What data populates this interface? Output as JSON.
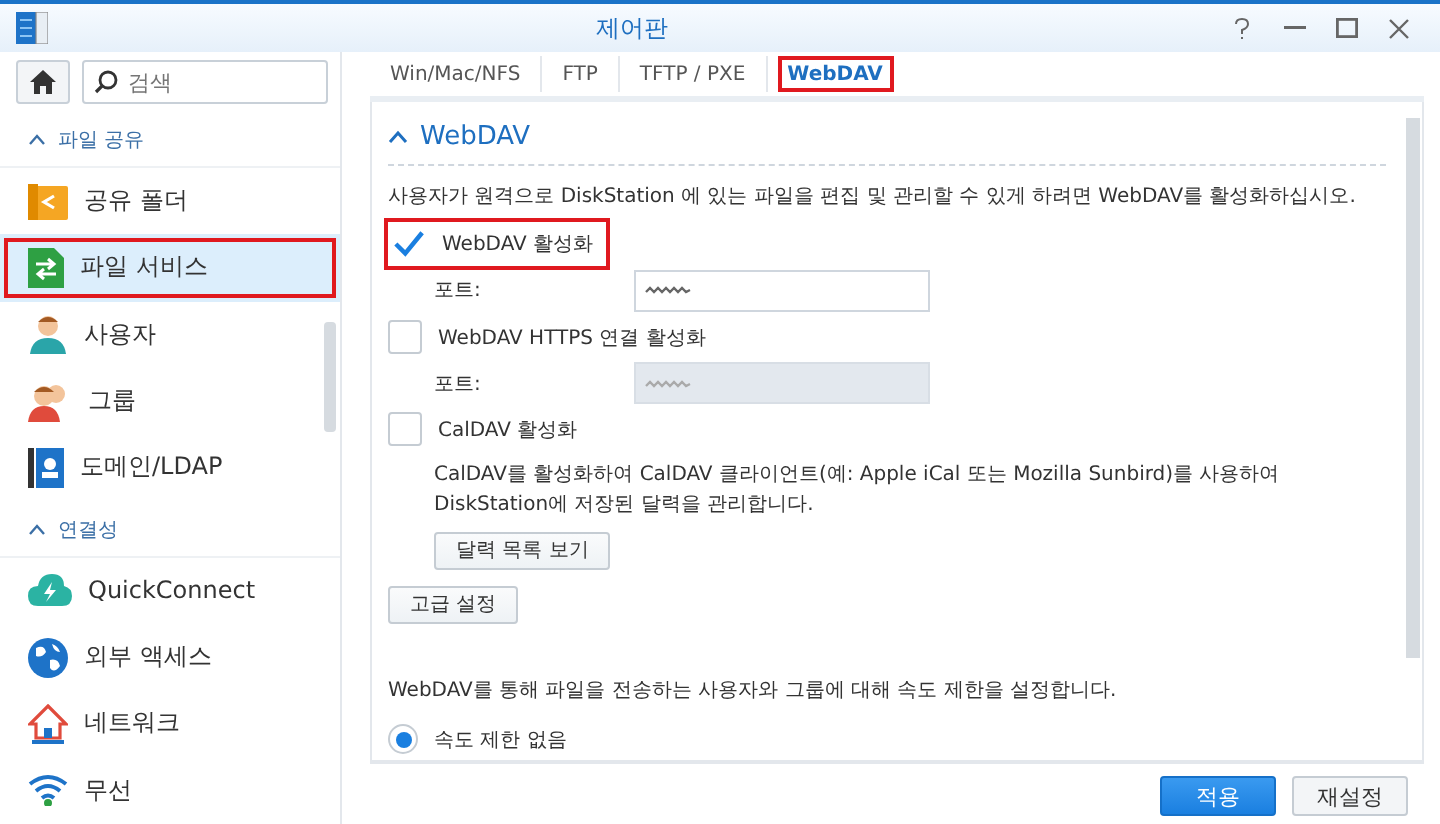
{
  "window": {
    "title": "제어판"
  },
  "search": {
    "placeholder": "검색"
  },
  "sidebar": {
    "items": [
      {
        "kind": "section",
        "label": "파일 공유",
        "expanded": true
      },
      {
        "kind": "item",
        "label": "공유 폴더",
        "selected": false,
        "highlighted": false
      },
      {
        "kind": "item",
        "label": "파일 서비스",
        "selected": true,
        "highlighted": true
      },
      {
        "kind": "item",
        "label": "사용자",
        "selected": false,
        "highlighted": false
      },
      {
        "kind": "item",
        "label": "그룹",
        "selected": false,
        "highlighted": false
      },
      {
        "kind": "item",
        "label": "도메인/LDAP",
        "selected": false,
        "highlighted": false
      },
      {
        "kind": "section",
        "label": "연결성",
        "expanded": true
      },
      {
        "kind": "item",
        "label": "QuickConnect",
        "selected": false,
        "highlighted": false
      },
      {
        "kind": "item",
        "label": "외부 액세스",
        "selected": false,
        "highlighted": false
      },
      {
        "kind": "item",
        "label": "네트워크",
        "selected": false,
        "highlighted": false
      },
      {
        "kind": "item",
        "label": "무선",
        "selected": false,
        "highlighted": false
      }
    ]
  },
  "tabs": [
    {
      "label": "Win/Mac/NFS",
      "selected": false,
      "highlighted": false
    },
    {
      "label": "FTP",
      "selected": false,
      "highlighted": false
    },
    {
      "label": "TFTP / PXE",
      "selected": false,
      "highlighted": false
    },
    {
      "label": "WebDAV",
      "selected": true,
      "highlighted": true
    }
  ],
  "panel": {
    "title": "WebDAV",
    "expanded": true,
    "description": "사용자가 원격으로 DiskStation 에 있는 파일을 편집 및 관리할 수 있게 하려면 WebDAV를 활성화하십시오.",
    "rows": [
      {
        "kind": "checkbox",
        "label": "WebDAV 활성화",
        "checked": true,
        "highlighted": true
      },
      {
        "kind": "port",
        "label": "포트:",
        "disabled": false
      },
      {
        "kind": "checkbox",
        "label": "WebDAV HTTPS 연결 활성화",
        "checked": false,
        "highlighted": false
      },
      {
        "kind": "port",
        "label": "포트:",
        "disabled": true
      },
      {
        "kind": "checkbox",
        "label": "CalDAV 활성화",
        "checked": false,
        "highlighted": false
      },
      {
        "kind": "note",
        "label": "CalDAV를 활성화하여 CalDAV 클라이언트(예: Apple iCal 또는 Mozilla Sunbird)를 사용하여 DiskStation에 저장된 달력을 관리합니다."
      },
      {
        "kind": "sub-button",
        "label": "달력 목록 보기"
      },
      {
        "kind": "button",
        "label": "고급 설정"
      },
      {
        "kind": "text",
        "label": "WebDAV를 통해 파일을 전송하는 사용자와 그룹에 대해 속도 제한을 설정합니다."
      },
      {
        "kind": "radio",
        "label": "속도 제한 없음",
        "selected": true
      }
    ]
  },
  "footer": {
    "buttons": [
      {
        "label": "적용",
        "kind": "primary"
      },
      {
        "label": "재설정",
        "kind": "secondary"
      }
    ]
  }
}
